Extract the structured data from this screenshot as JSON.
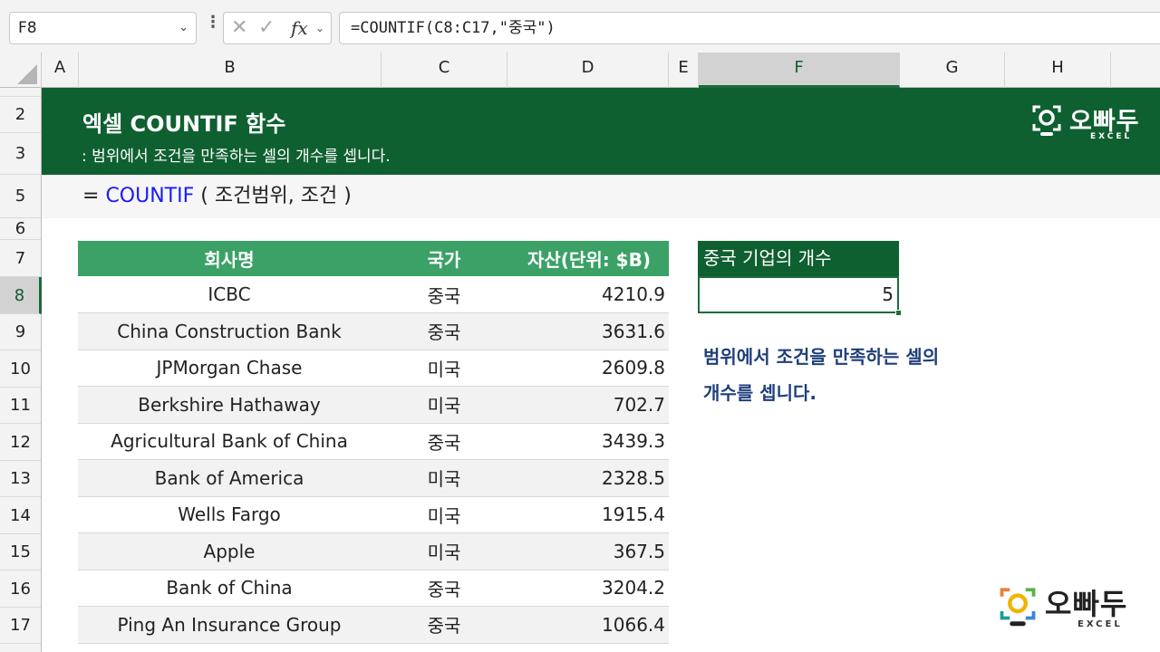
{
  "formula_bar": {
    "name_box": "F8",
    "cancel_glyph": "✕",
    "confirm_glyph": "✓",
    "fx_label": "fx",
    "formula": "=COUNTIF(C8:C17,\"중국\")"
  },
  "columns": [
    "A",
    "B",
    "C",
    "D",
    "E",
    "F",
    "G",
    "H"
  ],
  "selected_column": "F",
  "rows": [
    "2",
    "3",
    "5",
    "6",
    "7",
    "8",
    "9",
    "10",
    "11",
    "12",
    "13",
    "14",
    "15",
    "16",
    "17"
  ],
  "selected_row": "8",
  "banner": {
    "title": "엑셀 COUNTIF 함수",
    "subtitle": ": 범위에서 조건을 만족하는 셀의 개수를 셉니다."
  },
  "syntax": {
    "prefix": "= ",
    "function": "COUNTIF",
    "args": " ( 조건범위, 조건 )"
  },
  "table": {
    "headers": [
      "회사명",
      "국가",
      "자산(단위: $B)"
    ],
    "rows": [
      [
        "ICBC",
        "중국",
        "4210.9"
      ],
      [
        "China Construction Bank",
        "중국",
        "3631.6"
      ],
      [
        "JPMorgan Chase",
        "미국",
        "2609.8"
      ],
      [
        "Berkshire Hathaway",
        "미국",
        "702.7"
      ],
      [
        "Agricultural Bank of China",
        "중국",
        "3439.3"
      ],
      [
        "Bank of America",
        "미국",
        "2328.5"
      ],
      [
        "Wells Fargo",
        "미국",
        "1915.4"
      ],
      [
        "Apple",
        "미국",
        "367.5"
      ],
      [
        "Bank of China",
        "중국",
        "3204.2"
      ],
      [
        "Ping An Insurance Group",
        "중국",
        "1066.4"
      ]
    ]
  },
  "result": {
    "header": "중국 기업의 개수",
    "value": "5"
  },
  "description": {
    "line1": "범위에서 조건을 만족하는 셀의",
    "line2": "개수를 셉니다."
  },
  "logo": {
    "brand": "오빠두",
    "sub": "EXCEL"
  },
  "colors": {
    "banner_green": "#0f6030",
    "header_green": "#3ba167",
    "function_blue": "#1a1aff",
    "desc_navy": "#1f3f7a"
  }
}
